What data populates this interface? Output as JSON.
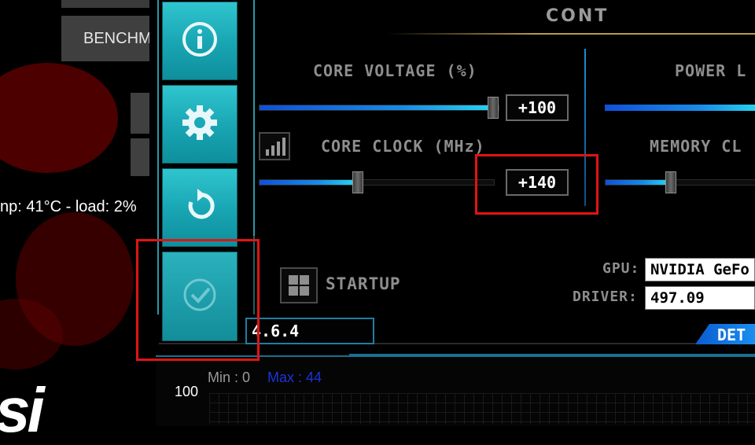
{
  "background_panel": {
    "benchmark_label": "BENCHM",
    "temp_load_text": "np: 41°C - load: 2%",
    "logo_text": "si"
  },
  "sidebar": {
    "buttons": [
      {
        "name": "info",
        "icon": "info-icon"
      },
      {
        "name": "settings",
        "icon": "gear-icon"
      },
      {
        "name": "reset",
        "icon": "reset-icon"
      },
      {
        "name": "apply",
        "icon": "check-icon"
      }
    ]
  },
  "header": {
    "title": "CONT"
  },
  "controls": {
    "core_voltage": {
      "label": "CORE VOLTAGE (%)",
      "value": "+100",
      "fill_fraction": 1.0
    },
    "power_limit": {
      "label": "POWER L"
    },
    "core_clock": {
      "label": "CORE CLOCK (MHz)",
      "value": "+140",
      "fill_fraction": 0.42
    },
    "memory_clock": {
      "label": "MEMORY CL"
    }
  },
  "startup": {
    "label": "STARTUP",
    "icon": "windows-icon"
  },
  "info": {
    "gpu_label": "GPU:",
    "gpu_value": "NVIDIA GeFo",
    "driver_label": "DRIVER:",
    "driver_value": "497.09"
  },
  "version": "4.6.4",
  "detail_button": "DET",
  "monitor": {
    "min_label": "Min : 0",
    "max_label": "Max : 44",
    "y_tick": "100"
  },
  "colors": {
    "accent_teal": "#1aa9b6",
    "slider_blue": "#1a8be6",
    "highlight_red": "#e01414"
  }
}
